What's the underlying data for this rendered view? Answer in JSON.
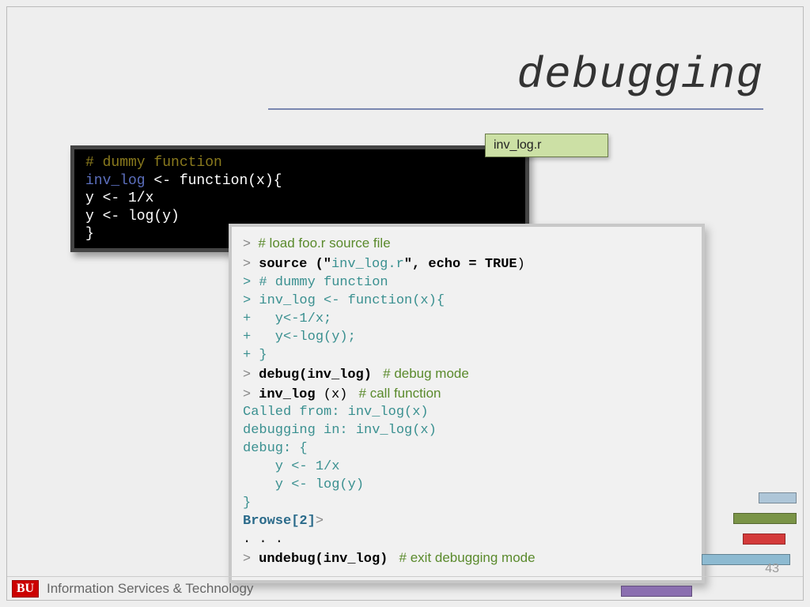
{
  "title": "debugging",
  "file_tag": "inv_log.r",
  "code_black": {
    "l1": "# dummy function",
    "l2a": "inv_log",
    "l2b": " <- function(x){",
    "l3": "   y <- 1/x",
    "l4": "   y <- log(y)",
    "l5": "}"
  },
  "console": {
    "gt": ">",
    "plus": "+",
    "l1_load": "  # load foo.r source file",
    "l2_source": "source ",
    "l2_open": "(\"",
    "l2_file": "inv_log.r",
    "l2_after": "\", ",
    "l2_echo": "echo = TRUE",
    "l2_close": ")",
    "l3": "> # dummy function",
    "l4": "> inv_log <- function(x){",
    "l5": "+   y<-1/x;",
    "l6": "+   y<-log(y);",
    "l7": "+ }",
    "l8_debug": "debug(inv_log)",
    "l8_com": "   # debug mode",
    "l9_call": "inv_log ",
    "l9_arg": "(x)",
    "l9_com": "   # call function",
    "l10": "Called from: inv_log(x)",
    "l11": "debugging in: inv_log(x)",
    "l12": "debug: {",
    "l13": "    y <- 1/x",
    "l14": "    y <- log(y)",
    "l15": "}",
    "l16": "Browse[2]",
    "l17": ". . .",
    "l18_undebug": "undebug(inv_log)",
    "l18_com": "   # exit debugging mode"
  },
  "footer": {
    "logo": "BU",
    "text": "Information Services & Technology"
  },
  "pagenum": "43"
}
